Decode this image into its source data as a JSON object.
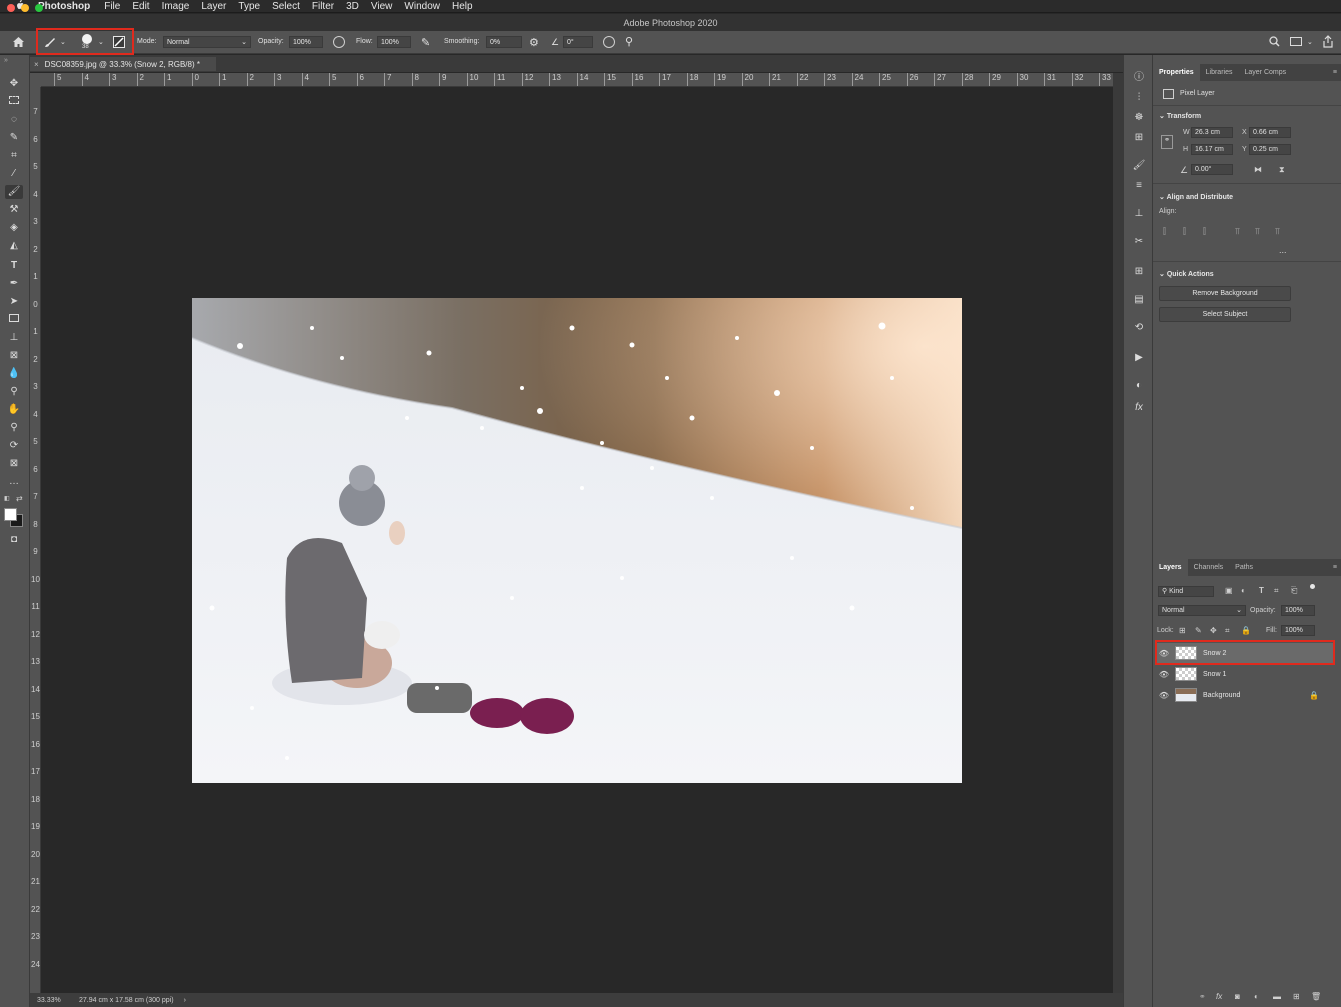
{
  "menubar": {
    "app_name": "Photoshop",
    "items": [
      "File",
      "Edit",
      "Image",
      "Layer",
      "Type",
      "Select",
      "Filter",
      "3D",
      "View",
      "Window",
      "Help"
    ]
  },
  "window": {
    "title": "Adobe Photoshop 2020"
  },
  "options_bar": {
    "brush_size": "38",
    "mode_label": "Mode:",
    "mode_value": "Normal",
    "opacity_label": "Opacity:",
    "opacity_value": "100%",
    "flow_label": "Flow:",
    "flow_value": "100%",
    "smoothing_label": "Smoothing:",
    "smoothing_value": "0%",
    "angle_value": "0°"
  },
  "document": {
    "tab_label": "DSC08359.jpg @ 33.3% (Snow 2, RGB/8) *",
    "close_glyph": "×",
    "zoom": "33.33%",
    "doc_size": "27.94 cm x 17.58 cm (300 ppi)"
  },
  "ruler": {
    "h_labels": [
      "5",
      "4",
      "3",
      "2",
      "1",
      "0",
      "1",
      "2",
      "3",
      "4",
      "5",
      "6",
      "7",
      "8",
      "9",
      "10",
      "11",
      "12",
      "13",
      "14",
      "15",
      "16",
      "17",
      "18",
      "19",
      "20",
      "21",
      "22",
      "23",
      "24",
      "25",
      "26",
      "27",
      "28",
      "29",
      "30",
      "31",
      "32",
      "33"
    ],
    "v_labels": [
      "7",
      "6",
      "5",
      "4",
      "3",
      "2",
      "1",
      "0",
      "1",
      "2",
      "3",
      "4",
      "5",
      "6",
      "7",
      "8",
      "9",
      "10",
      "11",
      "12",
      "13",
      "14",
      "15",
      "16",
      "17",
      "18",
      "19",
      "20",
      "21",
      "22",
      "23",
      "24"
    ]
  },
  "properties_panel": {
    "tabs": [
      "Properties",
      "Libraries",
      "Layer Comps"
    ],
    "layer_kind": "Pixel Layer",
    "transform_title": "Transform",
    "w_label": "W",
    "w_value": "26.3 cm",
    "x_label": "X",
    "x_value": "0.66 cm",
    "h_label": "H",
    "h_value": "16.17 cm",
    "y_label": "Y",
    "y_value": "0.25 cm",
    "angle_value": "0.00°",
    "align_title": "Align and Distribute",
    "align_label": "Align:",
    "more": "...",
    "quick_actions_title": "Quick Actions",
    "remove_bg_label": "Remove Background",
    "select_subject_label": "Select Subject"
  },
  "layers_panel": {
    "tabs": [
      "Layers",
      "Channels",
      "Paths"
    ],
    "filter_label": "Kind",
    "blend_mode": "Normal",
    "opacity_label": "Opacity:",
    "opacity_value": "100%",
    "lock_label": "Lock:",
    "fill_label": "Fill:",
    "fill_value": "100%",
    "layers": [
      {
        "name": "Snow 2",
        "selected": true
      },
      {
        "name": "Snow 1",
        "selected": false
      },
      {
        "name": "Background",
        "selected": false
      }
    ]
  },
  "colors": {
    "highlight": "#e02a1d",
    "panel_bg": "#535353",
    "canvas_bg": "#282828"
  }
}
